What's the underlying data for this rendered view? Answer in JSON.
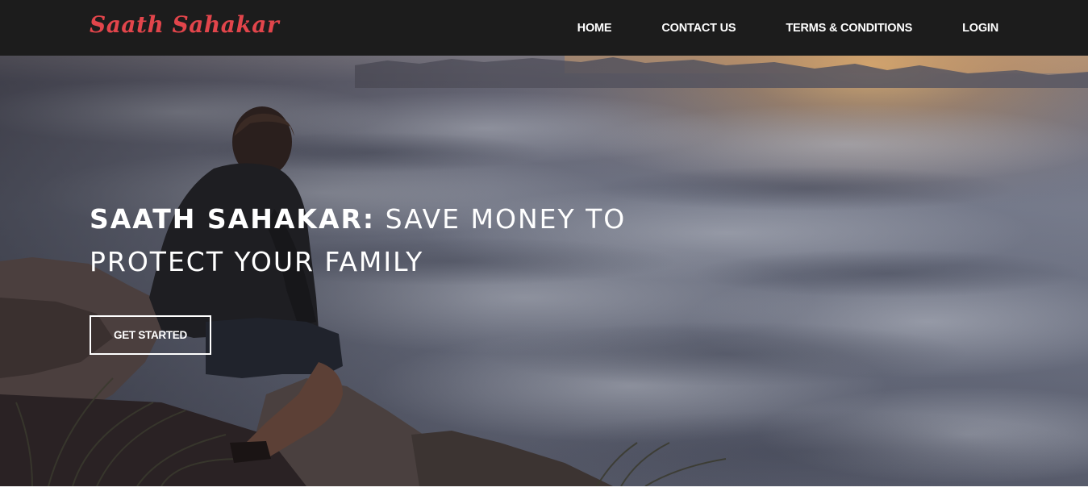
{
  "brand": {
    "name": "Saath Sahakar",
    "color": "#e2454b"
  },
  "nav": {
    "items": [
      {
        "label": "HOME"
      },
      {
        "label": "CONTACT US"
      },
      {
        "label": "TERMS & CONDITIONS"
      },
      {
        "label": "LOGIN"
      }
    ]
  },
  "hero": {
    "title_strong": "SAATH SAHAKAR:",
    "title_rest": " SAVE MONEY TO PROTECT YOUR FAMILY",
    "cta_label": "GET STARTED",
    "background": "photo: person seated on a rock overlooking a sea of clouds at sunrise"
  },
  "colors": {
    "navbar_bg": "#1c1c1c",
    "text": "#ffffff"
  }
}
